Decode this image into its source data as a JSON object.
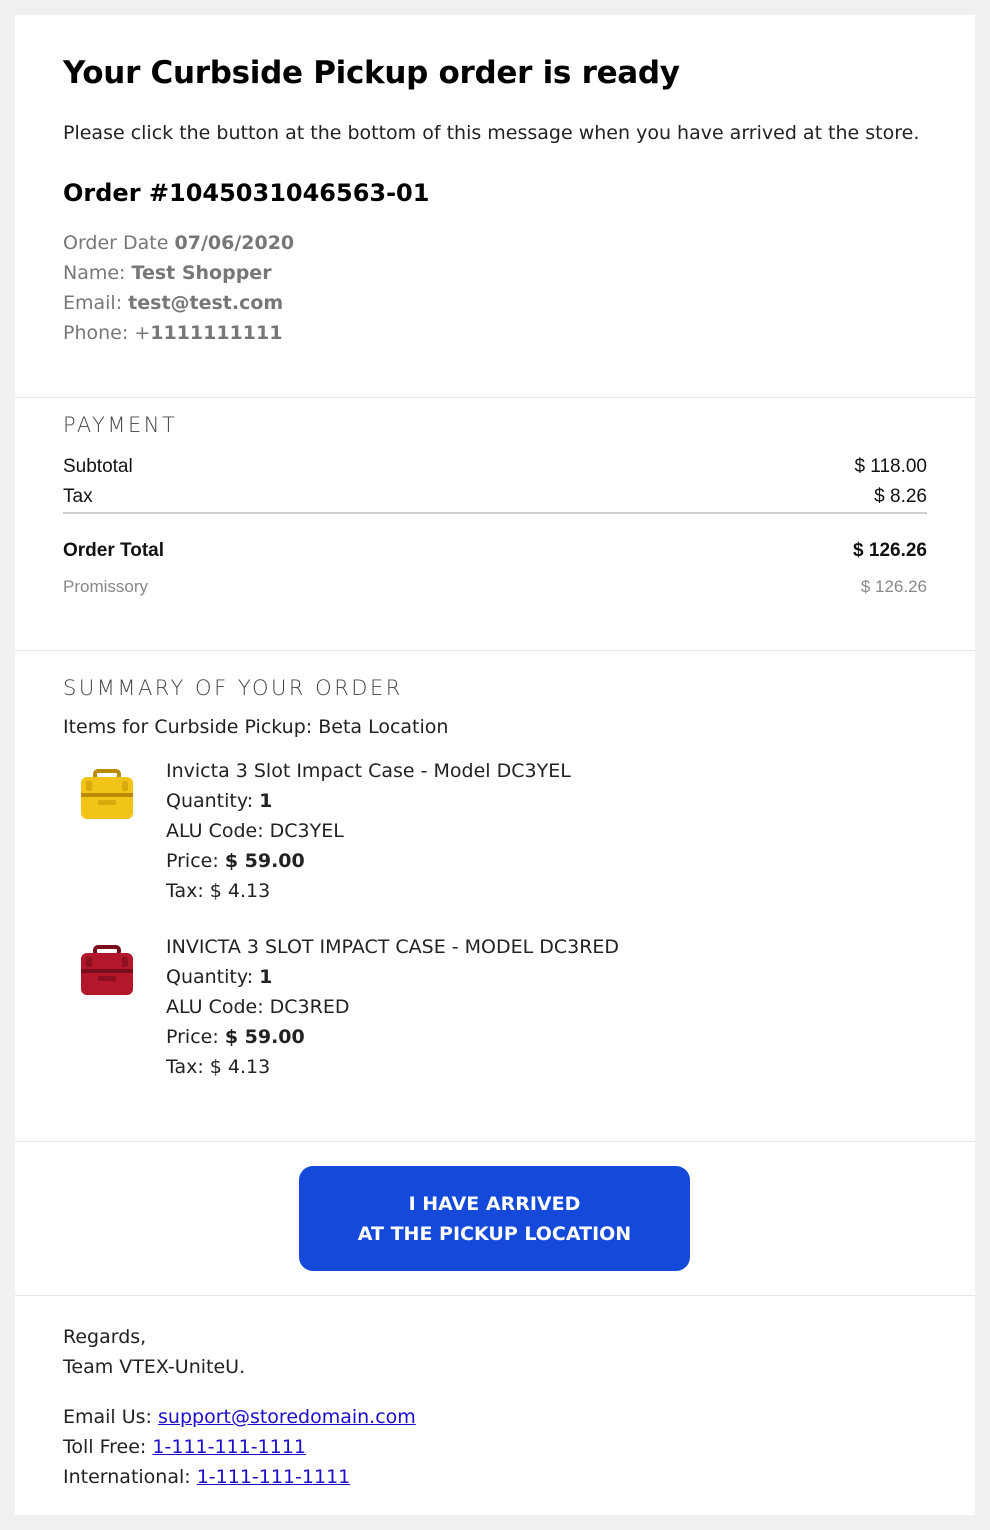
{
  "header": {
    "title": "Your Curbside Pickup order is ready",
    "intro": "Please click the button at the bottom of this message when you have arrived at the store."
  },
  "order": {
    "number_label": "Order #1045031046563-01",
    "date_label": "Order Date",
    "date_value": "07/06/2020",
    "name_label": "Name:",
    "name_value": "Test Shopper",
    "email_label": "Email:",
    "email_value": "test@test.com",
    "phone_label": "Phone:",
    "phone_prefix": "+",
    "phone_value": "1111111111"
  },
  "payment": {
    "heading": "PAYMENT",
    "subtotal_label": "Subtotal",
    "subtotal_value": "$ 118.00",
    "tax_label": "Tax",
    "tax_value": "$ 8.26",
    "total_label": "Order Total",
    "total_value": "$ 126.26",
    "method_label": "Promissory",
    "method_value": "$ 126.26"
  },
  "summary": {
    "heading": "SUMMARY OF YOUR ORDER",
    "location_line": "Items for Curbside Pickup: Beta Location",
    "items": [
      {
        "name": "Invicta 3 Slot Impact Case - Model DC3YEL",
        "quantity_label": "Quantity:",
        "quantity": "1",
        "alu": "ALU Code: DC3YEL",
        "price_label": "Price:",
        "price": "$ 59.00",
        "tax": "Tax: $ 4.13",
        "color": "#f2c417",
        "dark": "#b98c06"
      },
      {
        "name": "INVICTA 3 SLOT IMPACT CASE - MODEL DC3RED",
        "quantity_label": "Quantity:",
        "quantity": "1",
        "alu": "ALU Code: DC3RED",
        "price_label": "Price:",
        "price": "$ 59.00",
        "tax": "Tax: $ 4.13",
        "color": "#b3172c",
        "dark": "#7a0d1c"
      }
    ]
  },
  "cta": {
    "line1": "I HAVE ARRIVED",
    "line2": "AT THE PICKUP LOCATION",
    "color": "#1449d9"
  },
  "footer": {
    "regards": "Regards,",
    "team": "Team VTEX-UniteU.",
    "email_label": "Email Us:",
    "email": "support@storedomain.com",
    "tollfree_label": "Toll Free:",
    "tollfree": "1-111-111-1111",
    "intl_label": "International:",
    "intl": "1-111-111-1111"
  }
}
